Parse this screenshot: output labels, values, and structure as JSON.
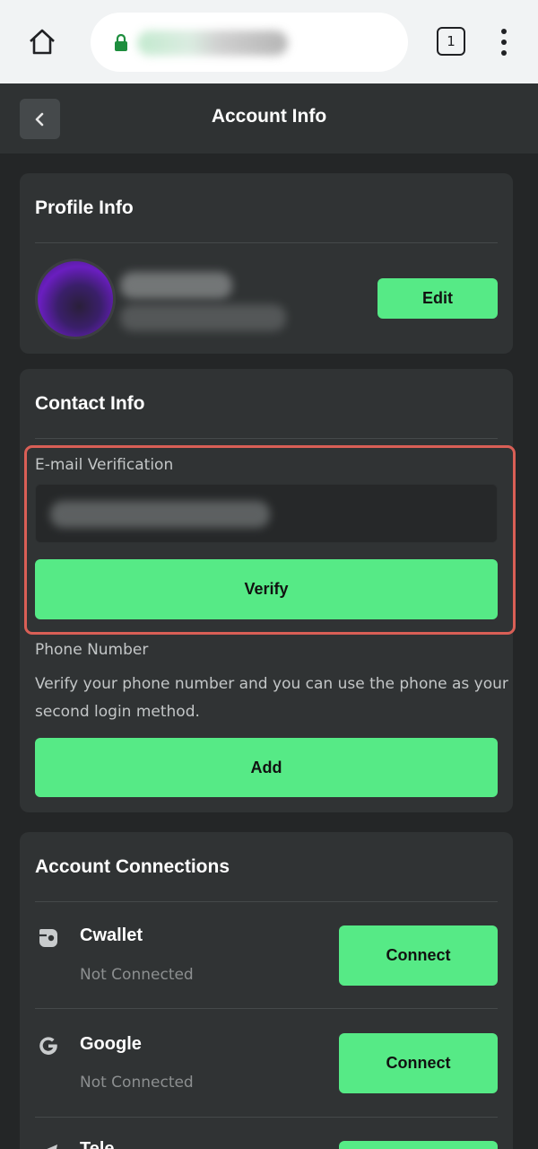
{
  "browser": {
    "tab_count": "1",
    "icons": {
      "home": "home-icon",
      "lock": "lock-icon",
      "tabs": "tabs-icon",
      "menu": "more-vert-icon"
    }
  },
  "header": {
    "title": "Account Info",
    "back_icon": "chevron-left-icon"
  },
  "profile": {
    "title": "Profile Info",
    "edit_label": "Edit"
  },
  "contact": {
    "title": "Contact Info",
    "email_label": "E-mail Verification",
    "verify_label": "Verify",
    "phone_label": "Phone Number",
    "phone_description": "Verify your phone number and you can use the phone as your second login method.",
    "add_label": "Add"
  },
  "connections": {
    "title": "Account Connections",
    "items": [
      {
        "name": "Cwallet",
        "status": "Not Connected",
        "button": "Connect",
        "icon": "cwallet-icon"
      },
      {
        "name": "Google",
        "status": "Not Connected",
        "button": "Connect",
        "icon": "google-icon"
      },
      {
        "name": "Tele",
        "status": "",
        "button": "",
        "icon": "telegram-icon"
      }
    ]
  },
  "colors": {
    "accent": "#56ea86",
    "background": "#242627",
    "card": "#303334",
    "highlight": "#d95f56"
  }
}
